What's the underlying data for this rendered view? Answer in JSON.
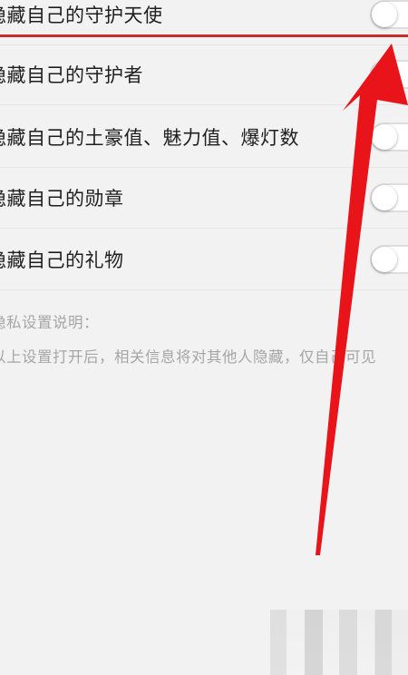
{
  "settings": {
    "items": [
      {
        "label": "隐藏自己的守护天使",
        "enabled": false
      },
      {
        "label": "隐藏自己的守护者",
        "enabled": false
      },
      {
        "label": "隐藏自己的土豪值、魅力值、爆灯数",
        "enabled": false
      },
      {
        "label": "隐藏自己的勋章",
        "enabled": false
      },
      {
        "label": "隐藏自己的礼物",
        "enabled": false
      }
    ]
  },
  "privacy_note": {
    "title": "隐私设置说明：",
    "description": "以上设置打开后，相关信息将对其他人隐藏，仅自己可见"
  },
  "colors": {
    "annotation_arrow": "#e8141a",
    "highlight_line": "#c92a2a",
    "background": "#f2f2f2"
  },
  "icons": {
    "annotation": "red-arrow-icon",
    "toggle": "toggle-switch-icon"
  }
}
